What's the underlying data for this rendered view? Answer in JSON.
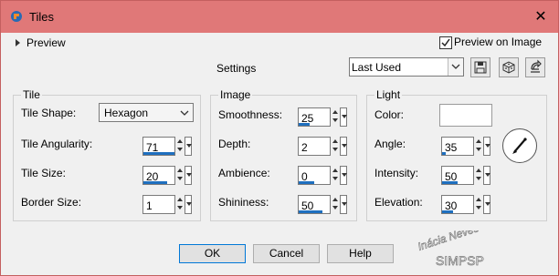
{
  "window": {
    "title": "Tiles"
  },
  "preview": {
    "label": "Preview"
  },
  "preview_on_image": {
    "label": "Preview on Image",
    "checked": true
  },
  "settings": {
    "label": "Settings",
    "preset_value": "Last Used"
  },
  "tile": {
    "title": "Tile",
    "shape_label": "Tile Shape:",
    "shape_value": "Hexagon",
    "angularity_label": "Tile Angularity:",
    "angularity_value": "71",
    "size_label": "Tile Size:",
    "size_value": "20",
    "border_label": "Border Size:",
    "border_value": "1"
  },
  "image": {
    "title": "Image",
    "smoothness_label": "Smoothness:",
    "smoothness_value": "25",
    "depth_label": "Depth:",
    "depth_value": "2",
    "ambience_label": "Ambience:",
    "ambience_value": "0",
    "shininess_label": "Shininess:",
    "shininess_value": "50"
  },
  "light": {
    "title": "Light",
    "color_label": "Color:",
    "color_value": "#ffffff",
    "angle_label": "Angle:",
    "angle_value": "35",
    "intensity_label": "Intensity:",
    "intensity_value": "50",
    "elevation_label": "Elevation:",
    "elevation_value": "30"
  },
  "buttons": {
    "ok": "OK",
    "cancel": "Cancel",
    "help": "Help"
  },
  "watermark": {
    "line1": "Inácia Neves",
    "line2": "SIMPSP"
  },
  "icons": [
    "app-icon",
    "close-icon",
    "save-preset-icon",
    "randomize-icon",
    "reset-icon",
    "direction-dial-icon"
  ]
}
